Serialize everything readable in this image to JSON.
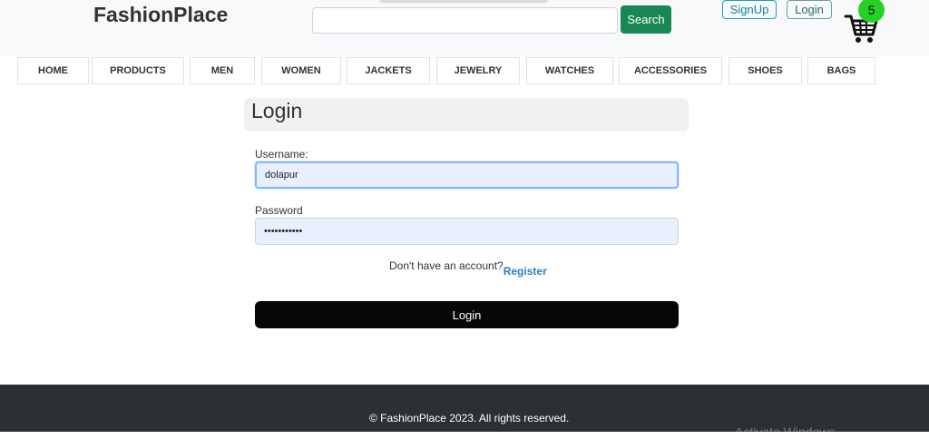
{
  "header": {
    "brand": "FashionPlace",
    "search_placeholder": "",
    "search_label": "Search",
    "signup_label": "SignUp",
    "login_label": "Login",
    "cart_count": "5"
  },
  "nav": {
    "items": [
      "HOME",
      "PRODUCTS",
      "MEN",
      "WOMEN",
      "JACKETS",
      "JEWELRY",
      "WATCHES",
      "ACCESSORIES",
      "SHOES",
      "BAGS"
    ]
  },
  "login_form": {
    "title": "Login",
    "username_label": "Username:",
    "username_value": "dolapur",
    "password_label": "Password",
    "password_value": "•••••••••••",
    "no_account_text": "Don't have an account?",
    "register_label": "Register",
    "submit_label": "Login"
  },
  "footer": {
    "copyright": "© FashionPlace 2023. All rights reserved.",
    "watermark": "Activate Windows"
  },
  "colors": {
    "search_button": "#198754",
    "cart_badge": "#26d126",
    "login_button": "#070707",
    "footer_bg": "#2b3035",
    "register_link": "#2a7fc0"
  }
}
